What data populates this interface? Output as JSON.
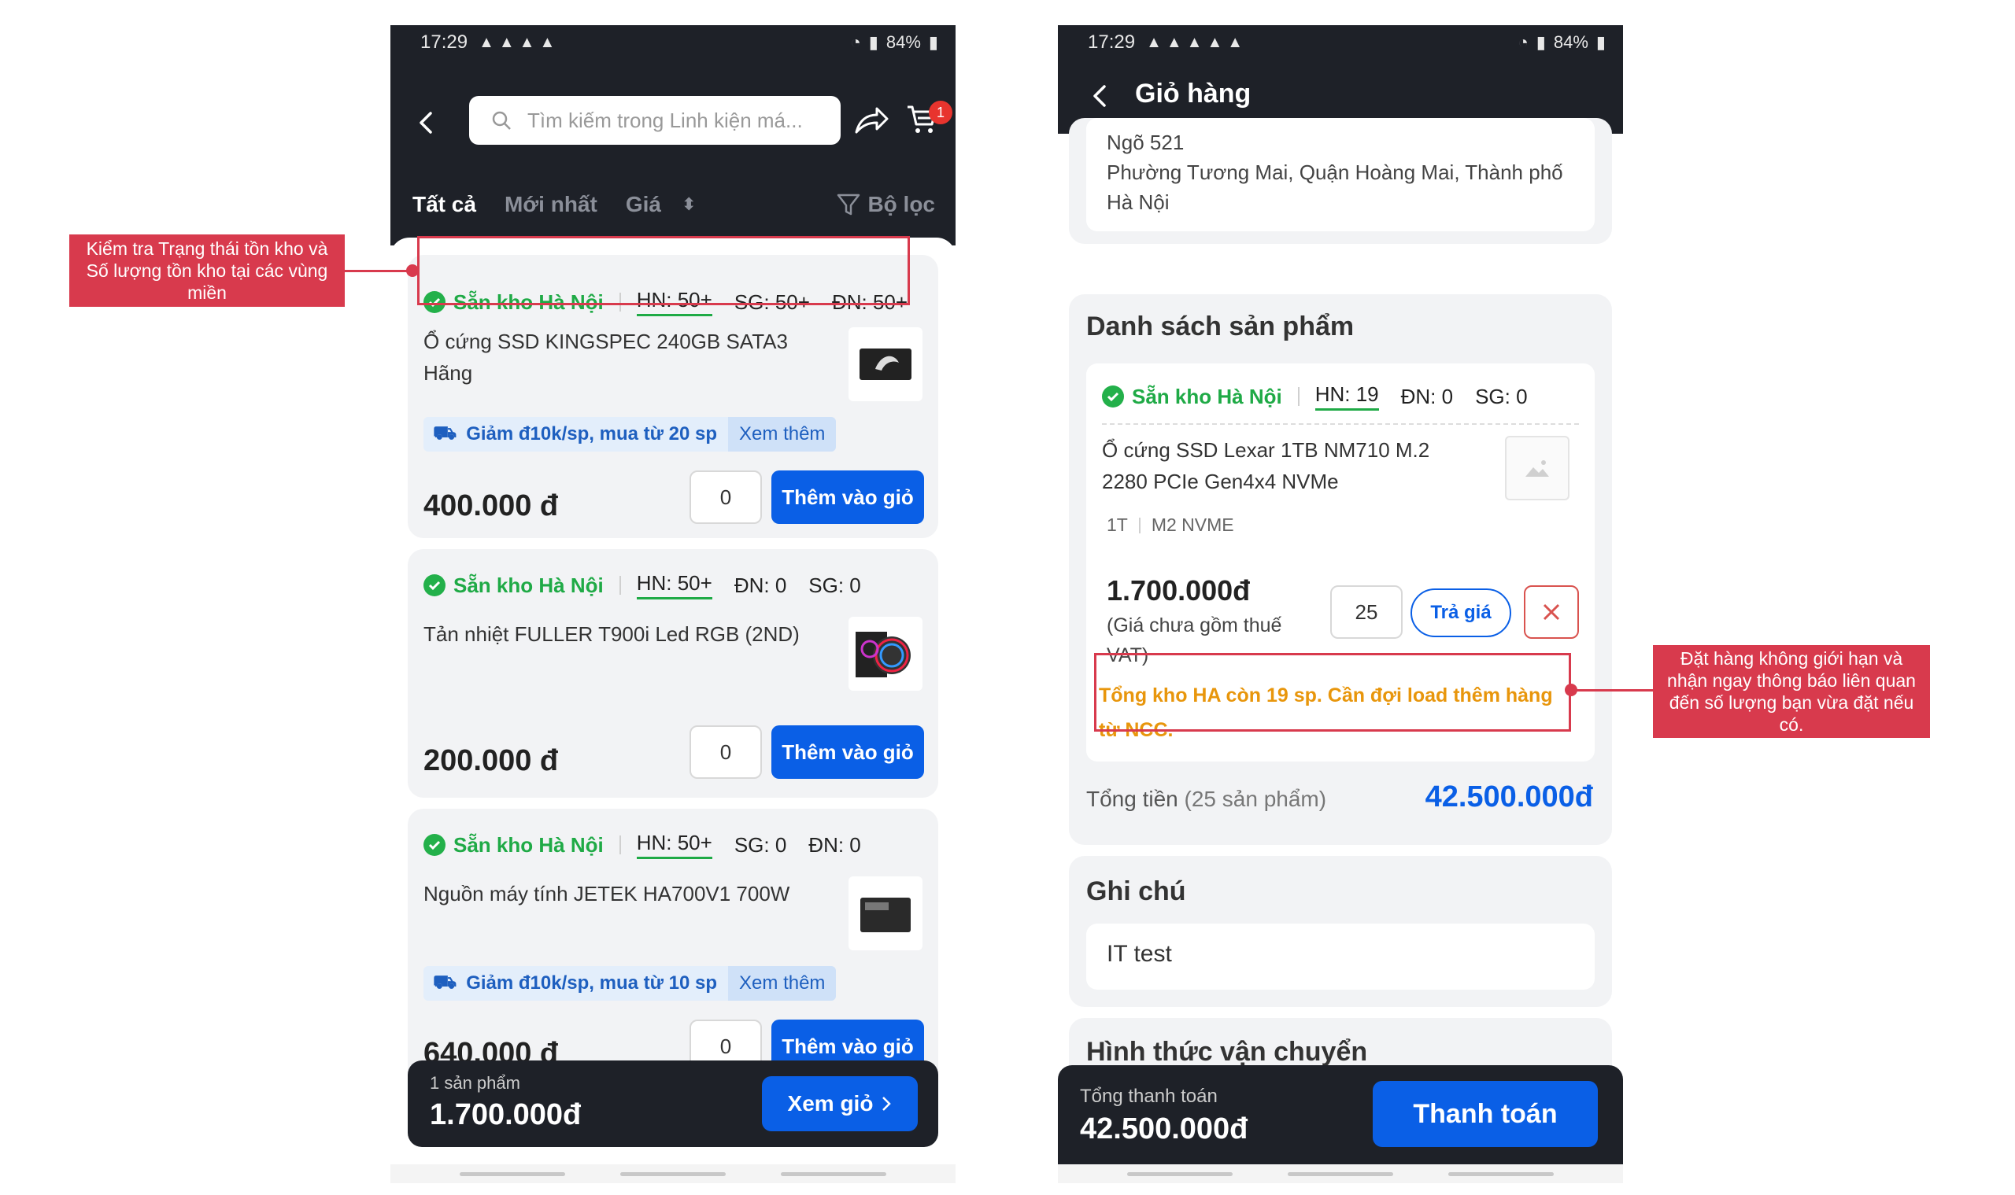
{
  "left_phone": {
    "status": {
      "time": "17:29",
      "battery": "84%"
    },
    "search_placeholder": "Tìm kiếm trong Linh kiện má...",
    "cart_badge": "1",
    "filters": {
      "all": "Tất cả",
      "newest": "Mới nhất",
      "price": "Giá",
      "filter": "Bộ lọc"
    },
    "products": [
      {
        "stock_label": "Sẵn kho Hà Nội",
        "hn": "HN: 50+",
        "r2": "SG: 50+",
        "r3": "ĐN: 50+",
        "name": "Ổ cứng SSD KINGSPEC 240GB SATA3\nHãng",
        "promo": "Giảm đ10k/sp, mua từ 20 sp",
        "promo_more": "Xem thêm",
        "price": "400.000 đ",
        "qty": "0",
        "add_label": "Thêm vào giỏ"
      },
      {
        "stock_label": "Sẵn kho Hà Nội",
        "hn": "HN: 50+",
        "r2": "ĐN: 0",
        "r3": "SG: 0",
        "name": "Tản nhiệt FULLER T900i Led RGB (2ND)",
        "price": "200.000 đ",
        "qty": "0",
        "add_label": "Thêm vào giỏ"
      },
      {
        "stock_label": "Sẵn kho Hà Nội",
        "hn": "HN: 50+",
        "r2": "SG: 0",
        "r3": "ĐN: 0",
        "name": "Nguồn máy tính JETEK HA700V1 700W",
        "promo": "Giảm đ10k/sp, mua từ 10 sp",
        "promo_more": "Xem thêm",
        "price": "640.000 đ",
        "qty": "0",
        "add_label": "Thêm vào giỏ"
      }
    ],
    "bottom": {
      "count": "1 sản phẩm",
      "total": "1.700.000đ",
      "view_cart": "Xem giỏ"
    }
  },
  "right_phone": {
    "status": {
      "time": "17:29",
      "battery": "84%"
    },
    "title": "Giỏ hàng",
    "address": "Ngõ 521\nPhường Tương Mai, Quận Hoàng Mai, Thành phố Hà Nội",
    "products_title": "Danh sách sản phẩm",
    "item": {
      "stock_label": "Sẵn kho Hà Nội",
      "hn": "HN: 19",
      "r2": "ĐN: 0",
      "r3": "SG: 0",
      "name": "Ổ cứng SSD Lexar 1TB NM710 M.2\n2280 PCIe Gen4x4 NVMe",
      "variant1": "1T",
      "variant2": "M2 NVME",
      "price": "1.700.000đ",
      "vat_note": "(Giá chưa gồm thuế\nVAT)",
      "qty": "25",
      "offer": "Trả giá",
      "warning": "Tổng kho HA còn 19 sp. Cần đợi load thêm hàng từ NCC."
    },
    "total_label": "Tổng tiền",
    "total_count": "(25 sản phẩm)",
    "total_value": "42.500.000đ",
    "note_title": "Ghi chú",
    "note_value": "IT test",
    "shipping_title": "Hình thức vận chuyển",
    "bottom": {
      "label": "Tổng thanh toán",
      "total": "42.500.000đ",
      "pay": "Thanh toán"
    }
  },
  "annotations": {
    "left": "Kiểm tra Trạng thái tồn kho và Số lượng tồn kho tại các vùng miền",
    "right": "Đặt hàng không giới hạn và nhận ngay thông báo liên quan đến số lượng bạn vừa đặt nếu có."
  },
  "colors": {
    "dark": "#1e2128",
    "primary": "#0a5fe6",
    "stock_green": "#1faa46",
    "annotation": "#d83a4d",
    "warning": "#e8960c"
  }
}
